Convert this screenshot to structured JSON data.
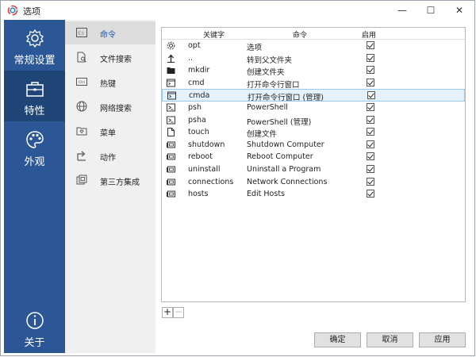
{
  "window": {
    "title": "选项",
    "min": "—",
    "max": "☐",
    "close": "✕"
  },
  "leftnav": {
    "items": [
      {
        "label": "常规设置",
        "icon": "gear-icon"
      },
      {
        "label": "特性",
        "icon": "briefcase-icon",
        "active": true
      },
      {
        "label": "外观",
        "icon": "palette-icon"
      },
      {
        "label": "关于",
        "icon": "info-icon"
      }
    ]
  },
  "subnav": {
    "items": [
      {
        "label": "命令",
        "icon": "command-icon",
        "active": true
      },
      {
        "label": "文件搜索",
        "icon": "file-search-icon"
      },
      {
        "label": "热键",
        "icon": "keyboard-icon"
      },
      {
        "label": "网络搜索",
        "icon": "globe-icon"
      },
      {
        "label": "菜单",
        "icon": "menu-icon"
      },
      {
        "label": "动作",
        "icon": "action-icon"
      },
      {
        "label": "第三方集成",
        "icon": "integration-icon"
      }
    ]
  },
  "table": {
    "headers": {
      "keyword": "关键字",
      "command": "命令",
      "enabled": "启用"
    },
    "rows": [
      {
        "icon": "gear-icon",
        "keyword": "opt",
        "command": "选项",
        "enabled": true
      },
      {
        "icon": "up-arrow-icon",
        "keyword": "..",
        "command": "转到父文件夹",
        "enabled": true
      },
      {
        "icon": "folder-icon",
        "keyword": "mkdir",
        "command": "创建文件夹",
        "enabled": true
      },
      {
        "icon": "cmd-window-icon",
        "keyword": "cmd",
        "command": "打开命令行窗口",
        "enabled": true
      },
      {
        "icon": "cmd-window-icon",
        "keyword": "cmda",
        "command": "打开命令行窗口 (管理)",
        "enabled": true,
        "selected": true
      },
      {
        "icon": "powershell-icon",
        "keyword": "psh",
        "command": "PowerShell",
        "enabled": true
      },
      {
        "icon": "powershell-icon",
        "keyword": "psha",
        "command": "PowerShell (管理)",
        "enabled": true
      },
      {
        "icon": "file-icon",
        "keyword": "touch",
        "command": "创建文件",
        "enabled": true
      },
      {
        "icon": "system-icon",
        "keyword": "shutdown",
        "command": "Shutdown Computer",
        "enabled": true
      },
      {
        "icon": "system-icon",
        "keyword": "reboot",
        "command": "Reboot Computer",
        "enabled": true
      },
      {
        "icon": "system-icon",
        "keyword": "uninstall",
        "command": "Uninstall a Program",
        "enabled": true
      },
      {
        "icon": "system-icon",
        "keyword": "connections",
        "command": "Network Connections",
        "enabled": true
      },
      {
        "icon": "system-icon",
        "keyword": "hosts",
        "command": "Edit Hosts",
        "enabled": true
      }
    ]
  },
  "table_controls": {
    "add": "+",
    "remove": "−"
  },
  "buttons": {
    "ok": "确定",
    "cancel": "取消",
    "apply": "应用"
  },
  "colors": {
    "nav_bg": "#2b5797",
    "nav_active": "#1f4476",
    "accent_text": "#1a56b8",
    "selected_row": "#e5f1fb"
  }
}
